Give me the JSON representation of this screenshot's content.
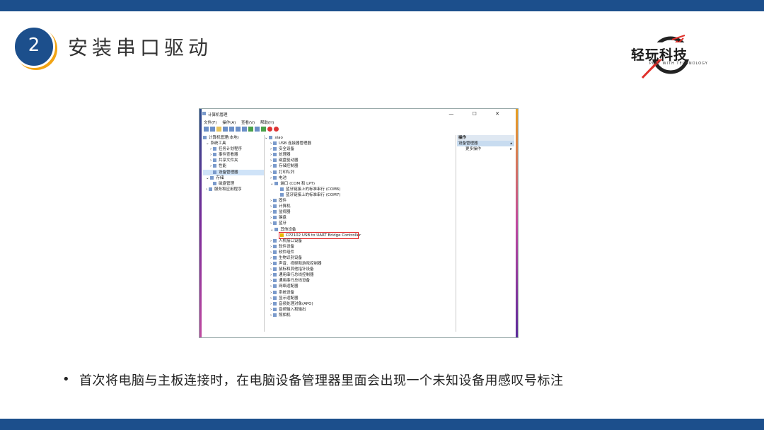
{
  "slide": {
    "number": "2",
    "title": "安装串口驱动",
    "logo_main": "轻玩科技",
    "logo_sub": "PLAY WITH TECHNOLOGY",
    "bullet": "•",
    "caption": "首次将电脑与主板连接时，在电脑设备管理器里面会出现一个未知设备用感叹号标注"
  },
  "window": {
    "title": "计算机管理",
    "controls": "— ☐ ✕",
    "menus": [
      "文件(F)",
      "操作(A)",
      "查看(V)",
      "帮助(H)"
    ],
    "left_tree": [
      "计算机管理(本地)",
      "系统工具",
      "任务计划程序",
      "事件查看器",
      "共享文件夹",
      "性能",
      "设备管理器",
      "存储",
      "磁盘管理",
      "服务和应用程序"
    ],
    "device_root": "xiao",
    "devices_before": [
      "USB 连接器管理器",
      "安全设备",
      "处理器",
      "磁盘驱动器",
      "存储控制器",
      "打印队列",
      "电池",
      "端口 (COM 和 LPT)",
      "蓝牙链接上的标准串行 (COM6)",
      "蓝牙链接上的标准串行 (COM7)",
      "固件",
      "计算机",
      "监视器",
      "键盘",
      "蓝牙",
      "其他设备"
    ],
    "unknown_device": "CP2102 USB to UART Bridge Controller",
    "devices_after": [
      "人机接口设备",
      "软件设备",
      "软件组件",
      "生物识别设备",
      "声音、视频和游戏控制器",
      "鼠标和其他指针设备",
      "通用串行总线控制器",
      "通用串行总线设备",
      "网络适配器",
      "系统设备",
      "显示适配器",
      "音频处理对象(APO)",
      "音频输入和输出",
      "照相机"
    ],
    "actions_header": "操作",
    "actions_section": "设备管理器",
    "actions_more": "更多操作"
  }
}
